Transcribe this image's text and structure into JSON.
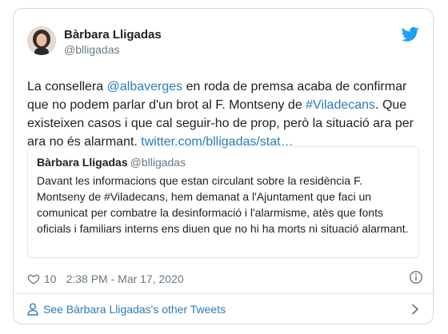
{
  "tweet": {
    "author_name": "Bàrbara Lligadas",
    "author_handle": "@blligadas",
    "text_before_mention": "La consellera ",
    "mention": "@albaverges",
    "text_middle": " en roda de premsa acaba de confirmar que no podem parlar d'un brot al F. Montseny de ",
    "hashtag": "#Viladecans",
    "text_after_hashtag": ". Que existeixen casos i que cal seguir-ho de prop, però la situació ara per ara no és alarmant. ",
    "link": "twitter.com/blligadas/stat…"
  },
  "quoted": {
    "author_name": "Bàrbara Lligadas",
    "author_handle": "@blligadas",
    "text": "Davant les informacions que estan circulant sobre la residència F. Montseny de #Viladecans, hem demanat a l'Ajuntament que faci un comunicat per combatre la desinformació i l'alarmisme, atès que fonts oficials i familiars interns ens diuen que no hi ha morts ni situació alarmant."
  },
  "meta": {
    "likes": "10",
    "timestamp": "2:38 PM - Mar 17, 2020"
  },
  "footer": {
    "label": "See Bàrbara Lligadas's other Tweets"
  },
  "colors": {
    "link": "#2b7bb9",
    "twitter_blue": "#1da1f2",
    "muted": "#697882"
  },
  "icons": [
    "twitter-bird-icon",
    "heart-icon",
    "info-icon",
    "person-icon",
    "chevron-right-icon"
  ]
}
